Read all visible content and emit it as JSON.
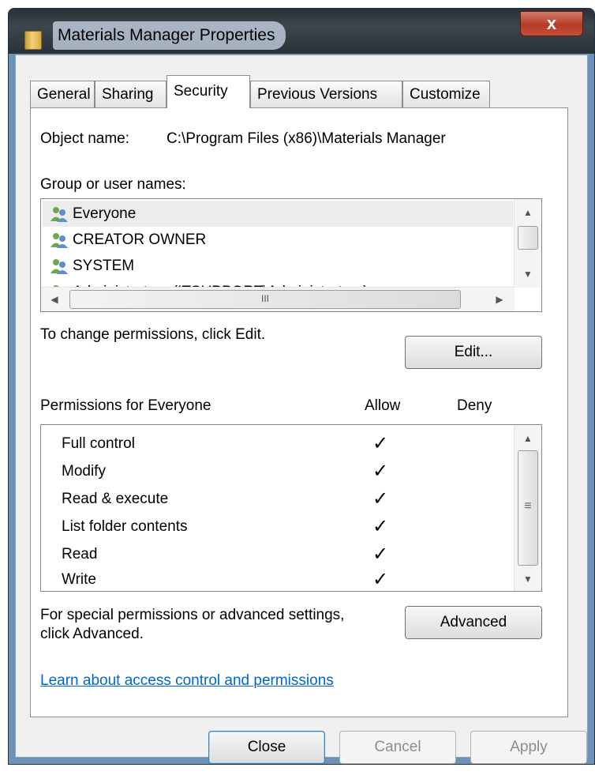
{
  "window": {
    "title": "Materials Manager Properties",
    "close_glyph": "x"
  },
  "tabs": [
    {
      "label": "General"
    },
    {
      "label": "Sharing"
    },
    {
      "label": "Security"
    },
    {
      "label": "Previous Versions"
    },
    {
      "label": "Customize"
    }
  ],
  "security": {
    "object_name_label": "Object name:",
    "object_name_value": "C:\\Program Files (x86)\\Materials Manager",
    "group_label": "Group or user names:",
    "users": [
      {
        "name": "Everyone",
        "selected": true
      },
      {
        "name": "CREATOR OWNER",
        "selected": false
      },
      {
        "name": "SYSTEM",
        "selected": false
      },
      {
        "name": "Administrators (ITSUPPORT\\Administrators)",
        "selected": false
      }
    ],
    "hscroll_grip": "III",
    "change_text": "To change permissions, click Edit.",
    "edit_button": "Edit...",
    "permissions_header": "Permissions for Everyone",
    "allow_header": "Allow",
    "deny_header": "Deny",
    "vscroll_grip": "≡",
    "permissions": [
      {
        "name": "Full control",
        "allow": "✓",
        "deny": ""
      },
      {
        "name": "Modify",
        "allow": "✓",
        "deny": ""
      },
      {
        "name": "Read & execute",
        "allow": "✓",
        "deny": ""
      },
      {
        "name": "List folder contents",
        "allow": "✓",
        "deny": ""
      },
      {
        "name": "Read",
        "allow": "✓",
        "deny": ""
      },
      {
        "name": "Write",
        "allow": "✓",
        "deny": ""
      }
    ],
    "advanced_text_line1": "For special permissions or advanced settings,",
    "advanced_text_line2": "click Advanced.",
    "advanced_button": "Advanced",
    "learn_link": "Learn about access control and permissions"
  },
  "footer": {
    "close": "Close",
    "cancel": "Cancel",
    "apply": "Apply"
  },
  "colors": {
    "link": "#0066cc",
    "title_bar": "#2a3036",
    "close_button": "#b63b28"
  }
}
